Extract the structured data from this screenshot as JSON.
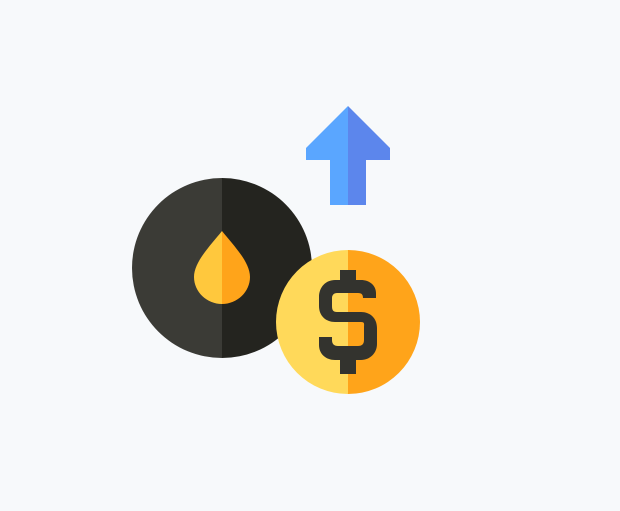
{
  "colors": {
    "background": "#f7f9fb",
    "arrow_left": "#5aa6ff",
    "arrow_right": "#5c86ec",
    "oil_coin_left": "#3b3b36",
    "oil_coin_right": "#24241f",
    "drop_left": "#ffc83d",
    "drop_right": "#ffa41a",
    "dollar_coin_left": "#ffd95a",
    "dollar_coin_right": "#ffa41a",
    "dollar_sign": "#33332e"
  },
  "icons": {
    "arrow": "up-arrow-icon",
    "oil": "oil-drop-icon",
    "coin": "dollar-coin-icon"
  }
}
